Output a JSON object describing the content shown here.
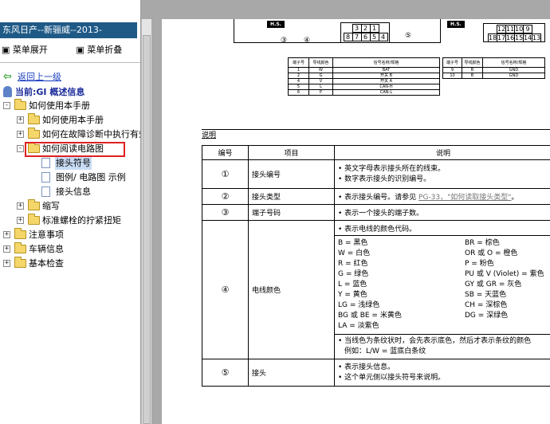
{
  "left_panel": {
    "title": "东风日产--新骊威--2013-",
    "expand_all": "菜单展开",
    "collapse_all": "菜单折叠",
    "back_link": "返回上一级",
    "current_label": "当前:GI 概述信息",
    "tree": [
      {
        "label": "如何使用本手册",
        "level": 0,
        "toggle": "-",
        "icon": "folder-open"
      },
      {
        "label": "如何使用本手册",
        "level": 1,
        "toggle": "+",
        "icon": "folder"
      },
      {
        "label": "如何在故障诊断中执行有效",
        "level": 1,
        "toggle": "+",
        "icon": "folder"
      },
      {
        "label": "如何阅读电路图",
        "level": 1,
        "toggle": "-",
        "icon": "folder-open",
        "highlighted": true
      },
      {
        "label": "接头符号",
        "level": 2,
        "icon": "page",
        "selected": true
      },
      {
        "label": "图例/ 电路图 示例",
        "level": 2,
        "icon": "page"
      },
      {
        "label": "接头信息",
        "level": 2,
        "icon": "page"
      },
      {
        "label": "缩写",
        "level": 1,
        "toggle": "+",
        "icon": "folder"
      },
      {
        "label": "标准螺栓的拧紧扭矩",
        "level": 1,
        "toggle": "+",
        "icon": "folder"
      },
      {
        "label": "注意事项",
        "level": 0,
        "toggle": "+",
        "icon": "folder"
      },
      {
        "label": "车辆信息",
        "level": 0,
        "toggle": "+",
        "icon": "folder"
      },
      {
        "label": "基本检查",
        "level": 0,
        "toggle": "+",
        "icon": "folder"
      }
    ],
    "highlight_color": "#e02020"
  },
  "diagram": {
    "hs_badge": "H.S.",
    "left_connector": {
      "top": [
        "3",
        "2",
        "1"
      ],
      "bottom": [
        "8",
        "7",
        "6",
        "5",
        "4"
      ]
    },
    "right_connector": {
      "top": [
        "12",
        "11",
        "10",
        "9"
      ],
      "bottom": [
        "18",
        "17",
        "16",
        "15",
        "14",
        "13"
      ]
    },
    "callouts": [
      "③",
      "④",
      "⑤"
    ],
    "pin_table_left": {
      "headers": [
        "端子号",
        "导线颜色",
        "信号名称/规格"
      ],
      "rows": [
        [
          "1",
          "W",
          "BAT"
        ],
        [
          "2",
          "G",
          "开关 B"
        ],
        [
          "4",
          "V",
          "开关 A"
        ],
        [
          "5",
          "L",
          "CAN-H"
        ],
        [
          "6",
          "P",
          "CAN-L"
        ]
      ]
    },
    "pin_table_right": {
      "headers": [
        "端子号",
        "导线颜色",
        "信号名称/规格"
      ],
      "rows": [
        [
          "9",
          "B",
          "GND"
        ],
        [
          "10",
          "B",
          "GND"
        ]
      ]
    }
  },
  "legend": {
    "section_title": "说明",
    "headers": [
      "编号",
      "项目",
      "说明"
    ],
    "rows": [
      {
        "num": "①",
        "item": "接头编号",
        "desc": [
          "• 英文字母表示接头所在的线束。",
          "• 数字表示接头的识别编号。"
        ]
      },
      {
        "num": "②",
        "item": "接头类型",
        "desc_prefix": "• 表示接头编号。请参见 ",
        "desc_link": "PG-33，\"如何读取接头类型\"",
        "desc_suffix": "。"
      },
      {
        "num": "③",
        "item": "端子号码",
        "desc": [
          "• 表示一个接头的端子数。"
        ]
      },
      {
        "num": "④",
        "item": "电线颜色",
        "desc_top": "• 表示电线的颜色代码。",
        "colors_left": [
          "B = 黑色",
          "W = 白色",
          "R = 红色",
          "G = 绿色",
          "L = 蓝色",
          "Y = 黄色",
          "LG = 浅绿色",
          "BG 或 BE = 米黄色",
          "LA = 淡紫色"
        ],
        "colors_right": [
          "BR = 棕色",
          "OR 或 O = 橙色",
          "P = 粉色",
          "PU 或 V (Violet) = 紫色",
          "GY 或 GR = 灰色",
          "SB = 天蓝色",
          "CH = 深棕色",
          "DG = 深绿色"
        ],
        "desc_bottom": [
          "• 当线色为条纹状时，会先表示底色，然后才表示条纹的颜色",
          "例如：L/W = 蓝底白条纹"
        ]
      },
      {
        "num": "⑤",
        "item": "接头",
        "desc": [
          "• 表示接头信息。",
          "• 这个单元侧以接头符号来说明。"
        ]
      }
    ]
  }
}
